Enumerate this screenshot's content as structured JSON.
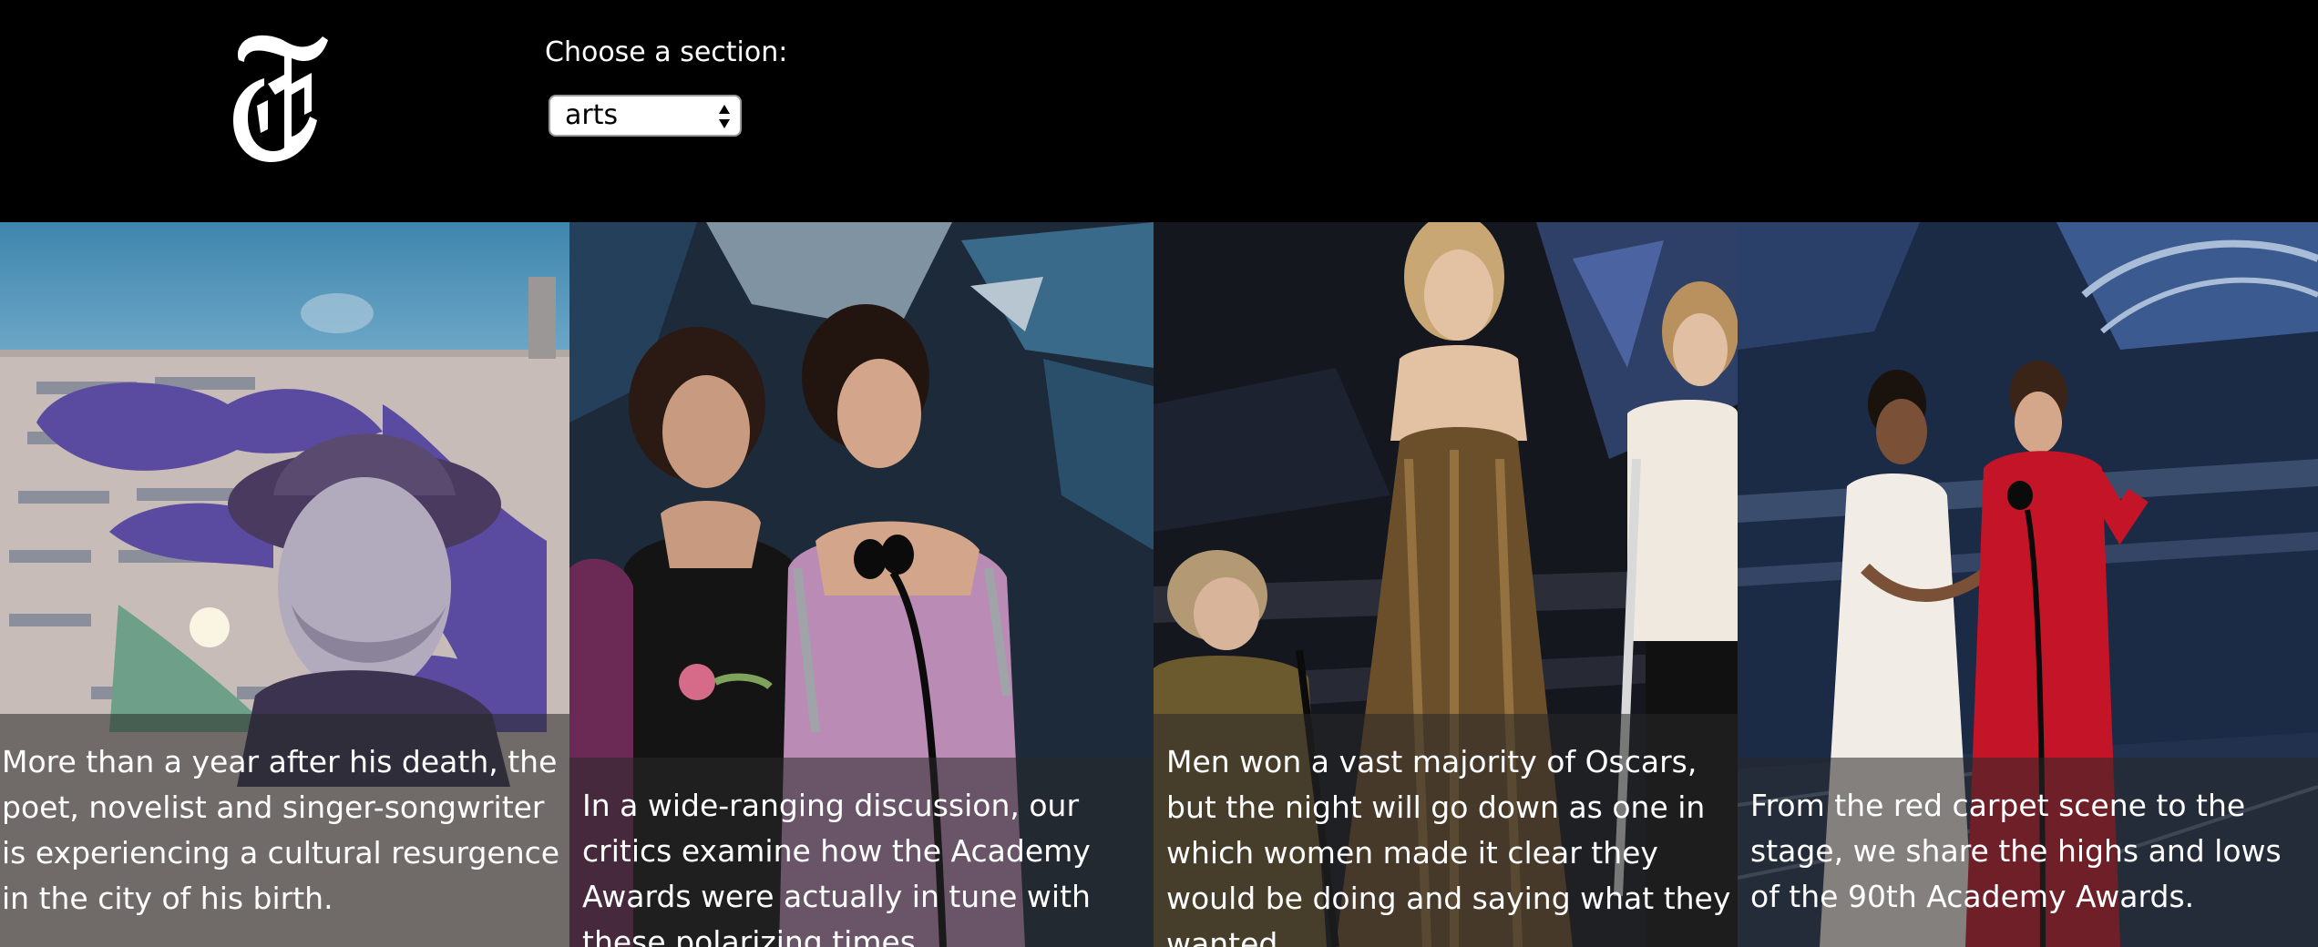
{
  "header": {
    "logo_icon": "nyt-t-logo-icon",
    "chooser_label": "Choose a section:",
    "section_select": {
      "selected": "arts",
      "arrow_icon": "select-arrows-icon"
    }
  },
  "stories": [
    {
      "caption": "More than a year after his death, the poet, novelist and singer-songwriter is experiencing a cultural resurgence in the city of his birth."
    },
    {
      "caption": "In a wide-ranging discussion, our critics examine how the Academy Awards were actually in tune with these polarizing times."
    },
    {
      "caption": "Men won a vast majority of Oscars, but the night will go down as one in which women made it clear they would be doing and saying what they wanted."
    },
    {
      "caption": "From the red carpet scene to the stage, we share the highs and lows of the 90th Academy Awards."
    }
  ]
}
